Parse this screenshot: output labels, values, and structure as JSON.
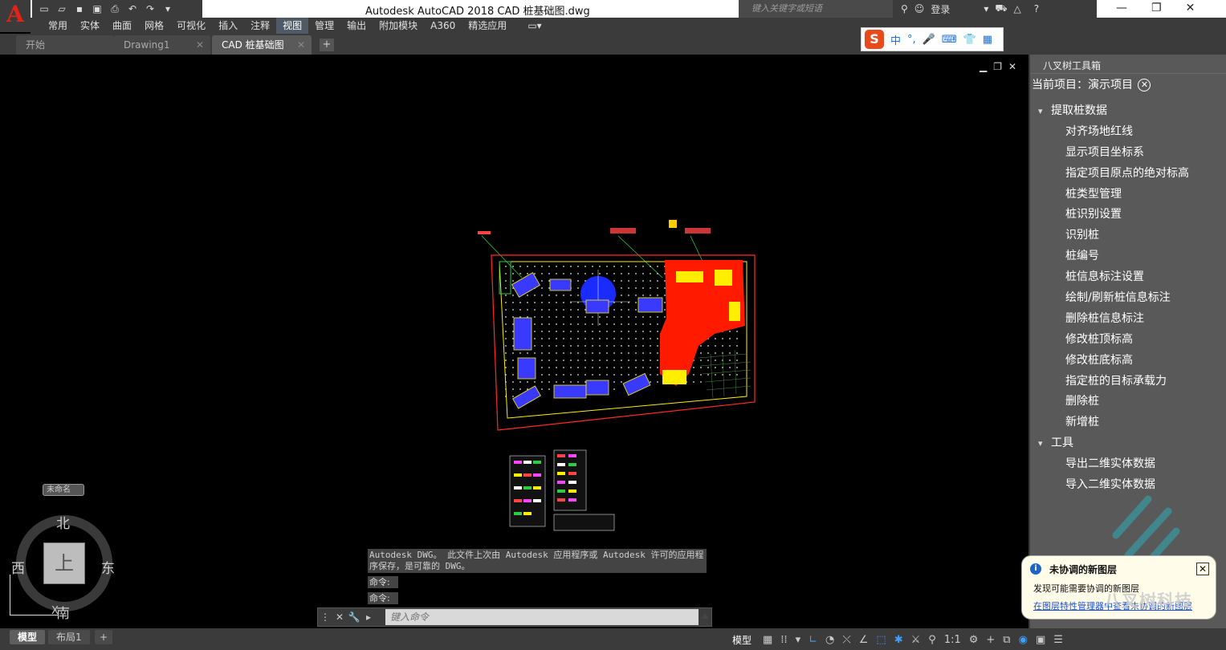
{
  "app": {
    "logo_letter": "A",
    "title": "Autodesk AutoCAD 2018    CAD 桩基础图.dwg",
    "search_placeholder": "键入关键字或短语",
    "login": "登录"
  },
  "ribbon": {
    "tabs": [
      "常用",
      "实体",
      "曲面",
      "网格",
      "可视化",
      "插入",
      "注释",
      "视图",
      "管理",
      "输出",
      "附加模块",
      "A360",
      "精选应用"
    ],
    "active": "视图"
  },
  "doc_tabs": {
    "tabs": [
      "开始",
      "Drawing1",
      "CAD 桩基础图"
    ],
    "active": "CAD 桩基础图",
    "add": "+"
  },
  "ime": {
    "logo": "S",
    "mode": "中",
    "punct": "°,"
  },
  "navcube": {
    "unnamed": "未命名",
    "north": "北",
    "south": "南",
    "east": "东",
    "west": "西",
    "face": "上",
    "axis_x": "X"
  },
  "command": {
    "history": "Autodesk DWG。 此文件上次由 Autodesk 应用程序或 Autodesk 许可的应用程序保存，是可靠的 DWG。",
    "prompt1": "命令:",
    "prompt2": "命令:",
    "placeholder": "键入命令"
  },
  "palette": {
    "title": "八叉树工具箱",
    "project": "当前项目：演示项目",
    "groups": [
      {
        "label": "提取桩数据",
        "items": [
          "对齐场地红线",
          "显示项目坐标系",
          "指定项目原点的绝对标高",
          "桩类型管理",
          "桩识别设置",
          "识别桩",
          "桩编号",
          "桩信息标注设置",
          "绘制/刷新桩信息标注",
          "删除桩信息标注",
          "修改桩顶标高",
          "修改桩底标高",
          "指定桩的目标承载力",
          "删除桩",
          "新增桩"
        ]
      },
      {
        "label": "工具",
        "items": [
          "导出二维实体数据",
          "导入二维实体数据"
        ]
      }
    ]
  },
  "notification": {
    "title": "未协调的新图层",
    "desc": "发现可能需要协调的新图层",
    "link": "在图层特性管理器中查看未协调的新图层"
  },
  "watermark_text": "八叉树科技",
  "statusbar": {
    "layout_tabs": [
      "模型",
      "布局1"
    ],
    "active": "模型",
    "model_label": "模型",
    "scale": "1:1"
  },
  "colors": {
    "accent_red": "#e2231a",
    "pile_region": "#ff1a00",
    "highlight_yellow": "#ffee00",
    "blue_zone": "#1a2bff",
    "link_blue": "#1a4fd6"
  }
}
